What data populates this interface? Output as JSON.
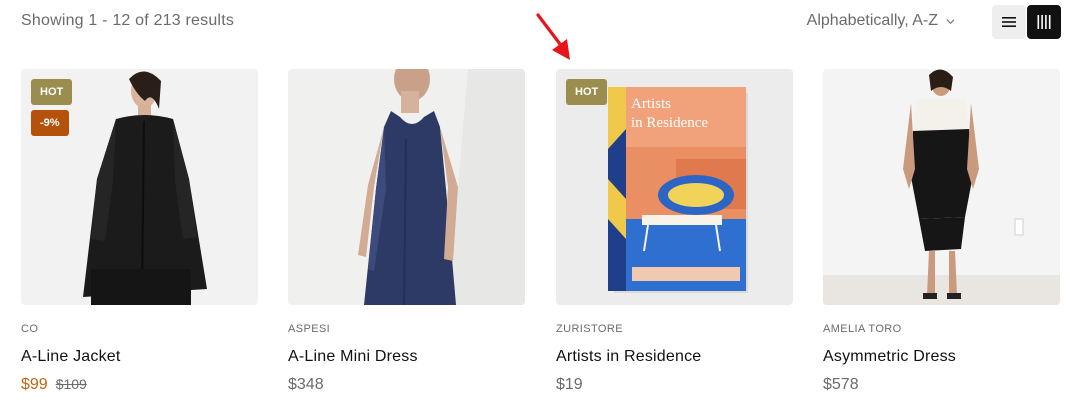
{
  "toolbar": {
    "result_count": "Showing 1 - 12 of 213 results",
    "sort_label": "Alphabetically, A-Z"
  },
  "annotation": {
    "arrow_color": "#e8141b"
  },
  "colors": {
    "accent_hot": "#9a8d4d",
    "accent_sale": "#b4510b",
    "sale_price": "#c4650f"
  },
  "products": [
    {
      "brand": "CO",
      "name": "A-Line Jacket",
      "price": "$99",
      "old_price": "$109",
      "badge_hot": "HOT",
      "badge_sale": "-9%"
    },
    {
      "brand": "ASPESI",
      "name": "A-Line Mini Dress",
      "price": "$348"
    },
    {
      "brand": "ZURISTORE",
      "name": "Artists in Residence",
      "price": "$19",
      "badge_hot": "HOT",
      "book_title": "Artists in Residence"
    },
    {
      "brand": "AMELIA TORO",
      "name": "Asymmetric Dress",
      "price": "$578"
    }
  ]
}
